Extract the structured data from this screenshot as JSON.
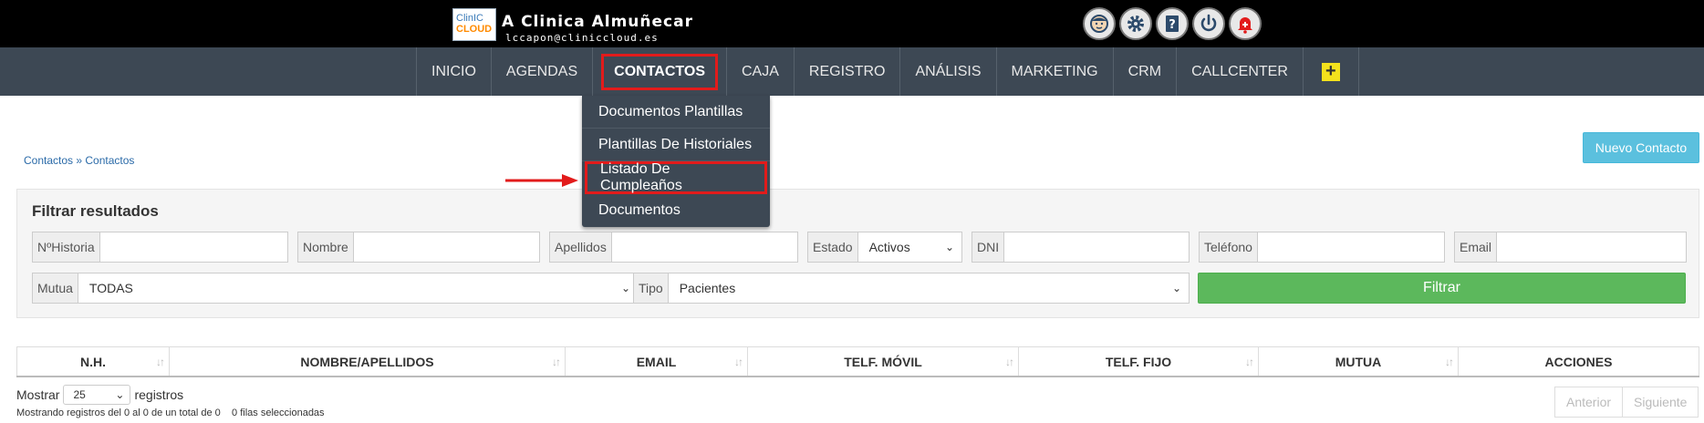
{
  "header": {
    "logo_top": "ClinIC",
    "logo_bottom": "CLOUD",
    "clinic_name": "A Clinica Almuñecar",
    "email": "lccapon@cliniccloud.es",
    "icons": [
      "user-face-icon",
      "gear-icon",
      "help-book-icon",
      "power-icon",
      "bell-alert-icon"
    ]
  },
  "nav": {
    "items": [
      "INICIO",
      "AGENDAS",
      "CONTACTOS",
      "CAJA",
      "REGISTRO",
      "ANÁLISIS",
      "MARKETING",
      "CRM",
      "CALLCENTER"
    ],
    "active": "CONTACTOS",
    "plus_label": "+"
  },
  "dropdown": {
    "items": [
      "Documentos Plantillas",
      "Plantillas De Historiales",
      "Listado De Cumpleaños",
      "Documentos"
    ],
    "highlighted": "Listado De Cumpleaños"
  },
  "breadcrumb": "Contactos » Contactos",
  "new_contact_label": "Nuevo Contacto",
  "filters": {
    "title": "Filtrar resultados",
    "historia_label": "NºHistoria",
    "nombre_label": "Nombre",
    "apellidos_label": "Apellidos",
    "estado_label": "Estado",
    "estado_value": "Activos",
    "dni_label": "DNI",
    "telefono_label": "Teléfono",
    "email_label": "Email",
    "mutua_label": "Mutua",
    "mutua_value": "TODAS",
    "tipo_label": "Tipo",
    "tipo_value": "Pacientes",
    "filtrar_label": "Filtrar"
  },
  "table": {
    "columns": [
      "N.H.",
      "NOMBRE/APELLIDOS",
      "EMAIL",
      "TELF. MÓVIL",
      "TELF. FIJO",
      "MUTUA",
      "ACCIONES"
    ]
  },
  "footer": {
    "mostrar": "Mostrar",
    "length_value": "25",
    "registros": "registros",
    "info": "Mostrando registros del 0 al 0 de un total de 0",
    "selected": "0 filas seleccionadas",
    "prev": "Anterior",
    "next": "Siguiente"
  },
  "colors": {
    "topbar": "#000000",
    "navbar": "#3d4854",
    "highlight": "#e21b1b",
    "filter_button": "#5cb85c",
    "new_button": "#5bc0de"
  }
}
